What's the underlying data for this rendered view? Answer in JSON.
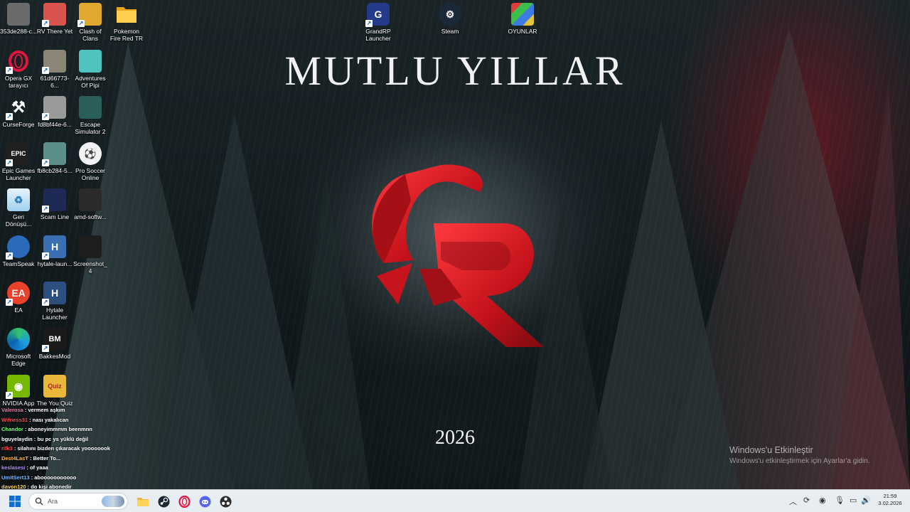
{
  "wallpaper": {
    "title": "MUTLU YILLAR",
    "year": "2026"
  },
  "activation": {
    "title": "Windows'u Etkinleştir",
    "subtitle": "Windows'u etkinleştirmek için Ayarlar'a gidin."
  },
  "desktop_icons": [
    {
      "label": "353de288-c...",
      "icon": "image-file-icon",
      "color": "#6b6b6b"
    },
    {
      "label": "RV There Yet",
      "icon": "game-icon",
      "color": "#d9534f"
    },
    {
      "label": "Clash of Clans",
      "icon": "game-icon",
      "color": "#e0a82e"
    },
    {
      "label": "Pokemon Fire Red TR",
      "icon": "folder-icon",
      "color": "#f2c14e"
    },
    {
      "label": "Opera GX tarayıcı",
      "icon": "opera-gx-icon",
      "color": "#d6183f"
    },
    {
      "label": "61d66773-6...",
      "icon": "image-file-icon",
      "color": "#8a8574"
    },
    {
      "label": "Adventures Of Pipi",
      "icon": "game-icon",
      "color": "#4fc3c0"
    },
    {
      "label": "CurseForge",
      "icon": "curseforge-icon",
      "color": "#222222"
    },
    {
      "label": "fd8bf44e-6...",
      "icon": "image-file-icon",
      "color": "#9a9a9a"
    },
    {
      "label": "Escape Simulator 2",
      "icon": "game-icon",
      "color": "#2a5e58"
    },
    {
      "label": "Epic Games Launcher",
      "icon": "epic-games-icon",
      "color": "#202020"
    },
    {
      "label": "fb8cb284-5...",
      "icon": "image-file-icon",
      "color": "#5c8f8a"
    },
    {
      "label": "Pro Soccer Online",
      "icon": "soccer-ball-icon",
      "color": "#333333"
    },
    {
      "label": "Geri Dönüşü...",
      "icon": "recycle-bin-icon",
      "color": "#4da3d8"
    },
    {
      "label": "Scam Line",
      "icon": "game-icon",
      "color": "#1d2a55"
    },
    {
      "label": "amd-softw...",
      "icon": "shield-icon",
      "color": "#2b2b2b"
    },
    {
      "label": "TeamSpeak",
      "icon": "teamspeak-icon",
      "color": "#2a6ab8"
    },
    {
      "label": "hytale-laun...",
      "icon": "hytale-icon",
      "color": "#3b6fb4"
    },
    {
      "label": "Screenshot_4",
      "icon": "image-file-icon",
      "color": "#1e1e1e"
    },
    {
      "label": "EA",
      "icon": "ea-icon",
      "color": "#e8412c"
    },
    {
      "label": "Hytale Launcher",
      "icon": "hytale-icon",
      "color": "#2c4f80"
    },
    {
      "label": "Microsoft Edge",
      "icon": "edge-icon",
      "color": "#1b9de2"
    },
    {
      "label": "BakkesMod",
      "icon": "bakkesmod-icon",
      "color": "#1a1a1a"
    },
    {
      "label": "NVIDIA App",
      "icon": "nvidia-icon",
      "color": "#76b900"
    },
    {
      "label": "The You Quiz",
      "icon": "quiz-icon",
      "color": "#e9b83a"
    },
    {
      "label": "GrandRP Launcher",
      "icon": "grandrp-icon",
      "color": "#263a8a"
    },
    {
      "label": "Steam",
      "icon": "steam-icon",
      "color": "#1b2838"
    },
    {
      "label": "OYUNLAR",
      "icon": "folder-colorful-icon",
      "color": "#6a3fbf"
    }
  ],
  "chat": [
    {
      "user": "Valerosa",
      "user_color": "#ff6ea8",
      "text": ": vermem aşkım"
    },
    {
      "user": "Wifness31",
      "user_color": "#ff4b4b",
      "text": ": nası yakalıcan"
    },
    {
      "user": "Chandor",
      "user_color": "#7cff7c",
      "text": ": aboneyimmmm beenmnn"
    },
    {
      "user": "bguyelaydin",
      "user_color": "#ffffff",
      "text": ": bu pc ys yüklü değil"
    },
    {
      "user": "rifk3",
      "user_color": "#ff4b4b",
      "text": ": silahını bizden çıkaracak yoooooook"
    },
    {
      "user": "Dest4LasT",
      "user_color": "#ffb347",
      "text": ": Better To..."
    },
    {
      "user": "keslasesi",
      "user_color": "#b58cff",
      "text": ": of yaaa"
    },
    {
      "user": "UmitSert13",
      "user_color": "#7ab8ff",
      "text": ": abooooooooooo"
    },
    {
      "user": "davon120",
      "user_color": "#ffd24d",
      "text": ": do kişi abonedir"
    }
  ],
  "taskbar": {
    "search_placeholder": "Ara",
    "apps": [
      "start-icon",
      "search-icon",
      "news-widget-icon",
      "file-explorer-icon",
      "steam-icon",
      "opera-gx-icon",
      "discord-icon",
      "obs-icon"
    ],
    "time": "21:59",
    "date": "3.02.2026"
  },
  "colors": {
    "taskbar_bg": "#e8edf1",
    "logo_red": "#d81f26",
    "windows_blue": "#0a6fd1"
  }
}
